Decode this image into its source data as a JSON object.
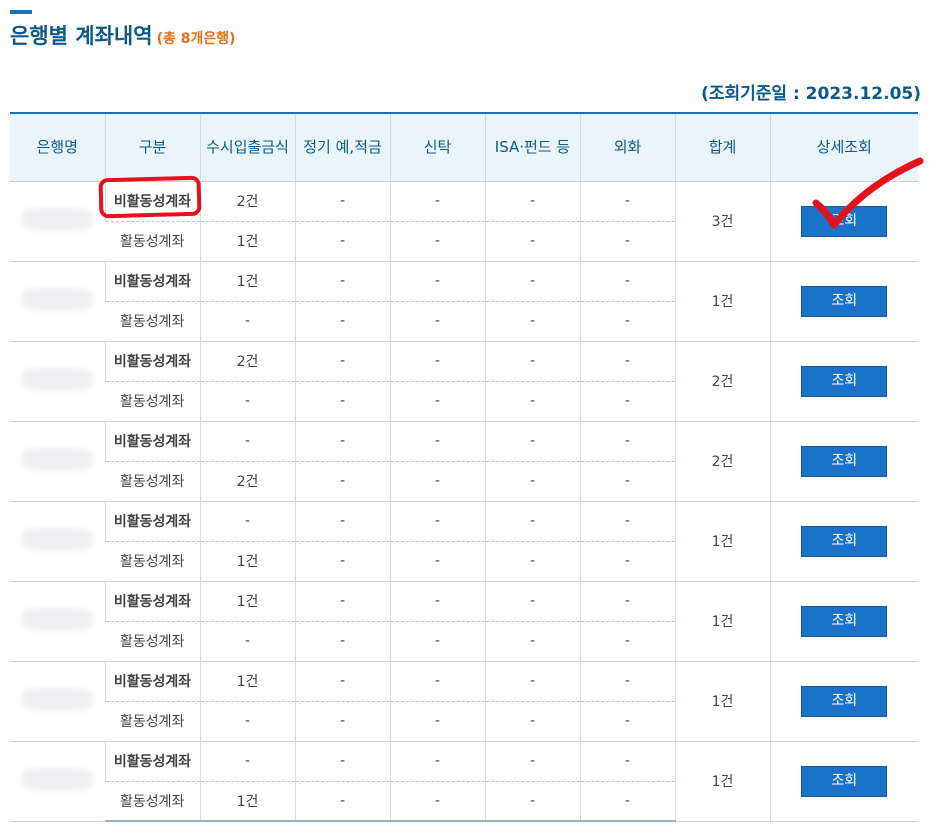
{
  "header": {
    "title": "은행별 계좌내역",
    "count_note": "(총 8개은행)",
    "ref_date": "(조회기준일 : 2023.12.05)"
  },
  "columns": [
    "은행명",
    "구분",
    "수시입출금식",
    "정기 예,적금",
    "신탁",
    "ISA·펀드 등",
    "외화",
    "합계",
    "상세조회"
  ],
  "banks": [
    {
      "name": "",
      "rows": [
        {
          "type": "비활동성계좌",
          "demand": "2건",
          "term": "-",
          "trust": "-",
          "isa": "-",
          "fx": "-"
        },
        {
          "type": "활동성계좌",
          "demand": "1건",
          "term": "-",
          "trust": "-",
          "isa": "-",
          "fx": "-"
        }
      ],
      "total": "3건",
      "action": "조회"
    },
    {
      "name": "",
      "rows": [
        {
          "type": "비활동성계좌",
          "demand": "1건",
          "term": "-",
          "trust": "-",
          "isa": "-",
          "fx": "-"
        },
        {
          "type": "활동성계좌",
          "demand": "-",
          "term": "-",
          "trust": "-",
          "isa": "-",
          "fx": "-"
        }
      ],
      "total": "1건",
      "action": "조회"
    },
    {
      "name": "",
      "rows": [
        {
          "type": "비활동성계좌",
          "demand": "2건",
          "term": "-",
          "trust": "-",
          "isa": "-",
          "fx": "-"
        },
        {
          "type": "활동성계좌",
          "demand": "-",
          "term": "-",
          "trust": "-",
          "isa": "-",
          "fx": "-"
        }
      ],
      "total": "2건",
      "action": "조회"
    },
    {
      "name": "",
      "rows": [
        {
          "type": "비활동성계좌",
          "demand": "-",
          "term": "-",
          "trust": "-",
          "isa": "-",
          "fx": "-"
        },
        {
          "type": "활동성계좌",
          "demand": "2건",
          "term": "-",
          "trust": "-",
          "isa": "-",
          "fx": "-"
        }
      ],
      "total": "2건",
      "action": "조회"
    },
    {
      "name": "",
      "rows": [
        {
          "type": "비활동성계좌",
          "demand": "-",
          "term": "-",
          "trust": "-",
          "isa": "-",
          "fx": "-"
        },
        {
          "type": "활동성계좌",
          "demand": "1건",
          "term": "-",
          "trust": "-",
          "isa": "-",
          "fx": "-"
        }
      ],
      "total": "1건",
      "action": "조회"
    },
    {
      "name": "",
      "rows": [
        {
          "type": "비활동성계좌",
          "demand": "1건",
          "term": "-",
          "trust": "-",
          "isa": "-",
          "fx": "-"
        },
        {
          "type": "활동성계좌",
          "demand": "-",
          "term": "-",
          "trust": "-",
          "isa": "-",
          "fx": "-"
        }
      ],
      "total": "1건",
      "action": "조회"
    },
    {
      "name": "",
      "rows": [
        {
          "type": "비활동성계좌",
          "demand": "1건",
          "term": "-",
          "trust": "-",
          "isa": "-",
          "fx": "-"
        },
        {
          "type": "활동성계좌",
          "demand": "-",
          "term": "-",
          "trust": "-",
          "isa": "-",
          "fx": "-"
        }
      ],
      "total": "1건",
      "action": "조회"
    },
    {
      "name": "",
      "rows": [
        {
          "type": "비활동성계좌",
          "demand": "-",
          "term": "-",
          "trust": "-",
          "isa": "-",
          "fx": "-"
        },
        {
          "type": "활동성계좌",
          "demand": "1건",
          "term": "-",
          "trust": "-",
          "isa": "-",
          "fx": "-"
        }
      ],
      "total": "1건",
      "action": "조회"
    }
  ],
  "colors": {
    "title": "#0b5a8f",
    "count_note": "#e07020",
    "header_bg": "#eaf4fb",
    "button": "#1a73c8",
    "marker": "#e8101c"
  },
  "annotations": {
    "circle_target": "비활동성계좌",
    "check_target": "조회"
  }
}
